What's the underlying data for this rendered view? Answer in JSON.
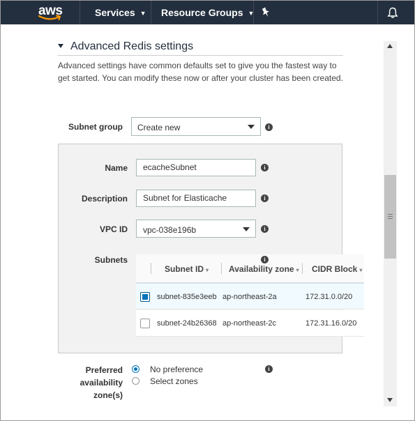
{
  "topnav": {
    "logo_text": "aws",
    "services_label": "Services",
    "resource_groups_label": "Resource Groups",
    "pin_icon": "pin-icon",
    "bell_icon": "bell-icon",
    "background": "#232f3e",
    "accent": "#ff9900"
  },
  "section": {
    "title": "Advanced Redis settings",
    "description": "Advanced settings have common defaults set to give you the fastest way to get started. You can modify these now or after your cluster has been created."
  },
  "subnet_group": {
    "label": "Subnet group",
    "value": "Create new"
  },
  "new_subnet": {
    "name_label": "Name",
    "name_value": "ecacheSubnet",
    "description_label": "Description",
    "description_value": "Subnet for Elasticache",
    "vpc_label": "VPC ID",
    "vpc_value": "vpc-038e196b",
    "subnets_label": "Subnets"
  },
  "subnets_table": {
    "columns": [
      "Subnet ID",
      "Availability zone",
      "CIDR Block"
    ],
    "rows": [
      {
        "subnet_id": "subnet-835e3eeb",
        "az": "ap-northeast-2a",
        "cidr": "172.31.0.0/20",
        "selected": true
      },
      {
        "subnet_id": "subnet-24b26368",
        "az": "ap-northeast-2c",
        "cidr": "172.31.16.0/20",
        "selected": false
      }
    ],
    "selected_color": "#0073bb"
  },
  "preferred_az": {
    "label_line1": "Preferred",
    "label_line2": "availability",
    "label_line3": "zone(s)",
    "options": [
      "No preference",
      "Select zones"
    ],
    "selected": "No preference"
  },
  "info_icon_glyph": "i"
}
